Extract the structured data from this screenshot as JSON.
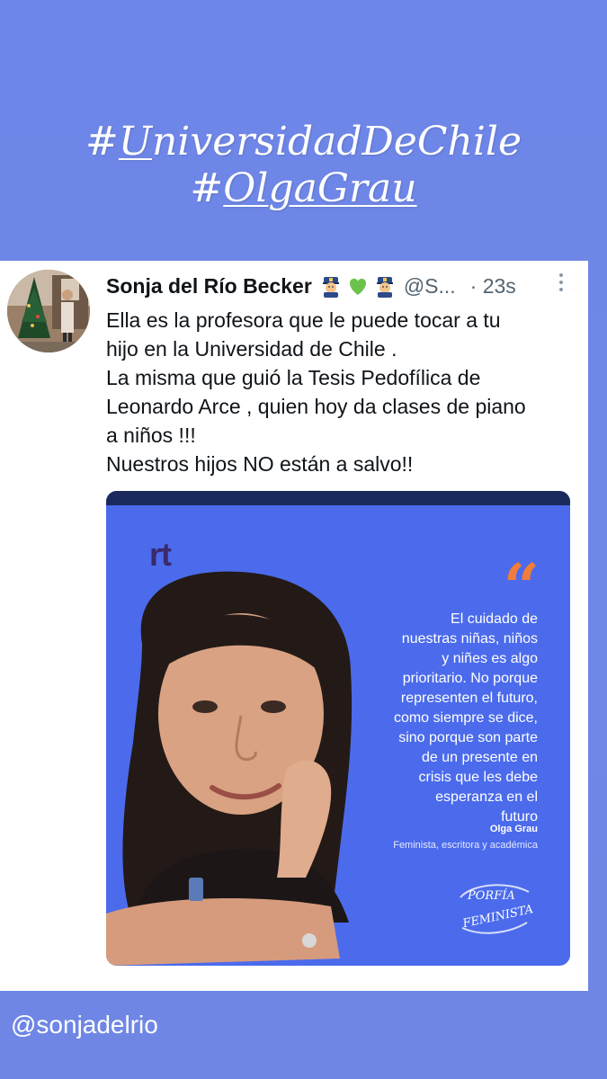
{
  "story": {
    "hashtags": [
      {
        "lead": "#",
        "underlined": "U",
        "rest": "niversidadDeChile"
      },
      {
        "lead": "#",
        "underlined": "OlgaGrau",
        "rest": ""
      }
    ],
    "footer_handle": "@sonjadelrio",
    "background_color": "#6f86e6"
  },
  "tweet": {
    "display_name": "Sonja del Río Becker",
    "emoji_icons": [
      "police-officer-icon",
      "green-heart-icon",
      "police-officer-icon"
    ],
    "handle": "@S...",
    "time": "· 23s",
    "text_lines": [
      "Ella es la profesora que le puede tocar a tu",
      "hijo en la Universidad de Chile .",
      "La misma que guió la Tesis Pedofílica de",
      "Leonardo Arce , quien hoy da clases de piano",
      "a niños !!!",
      "Nuestros hijos NO están a salvo!!"
    ],
    "media": {
      "logo_text": "rt",
      "quote_mark": "“",
      "quote_lines": [
        "El cuidado de",
        "nuestras niñas, niños",
        "y niñes es algo",
        "prioritario. No porque",
        "representen el futuro,",
        "como siempre se dice,",
        "sino porque son parte",
        "de un presente en",
        "crisis que les debe",
        "esperanza en el",
        "futuro"
      ],
      "author": "Olga Grau",
      "author_role": "Feminista, escritora y académica",
      "badge_text": "PORFÍA FEMINISTA",
      "accent_color": "#f07d3a",
      "media_bg_color": "#4b6bec"
    }
  }
}
